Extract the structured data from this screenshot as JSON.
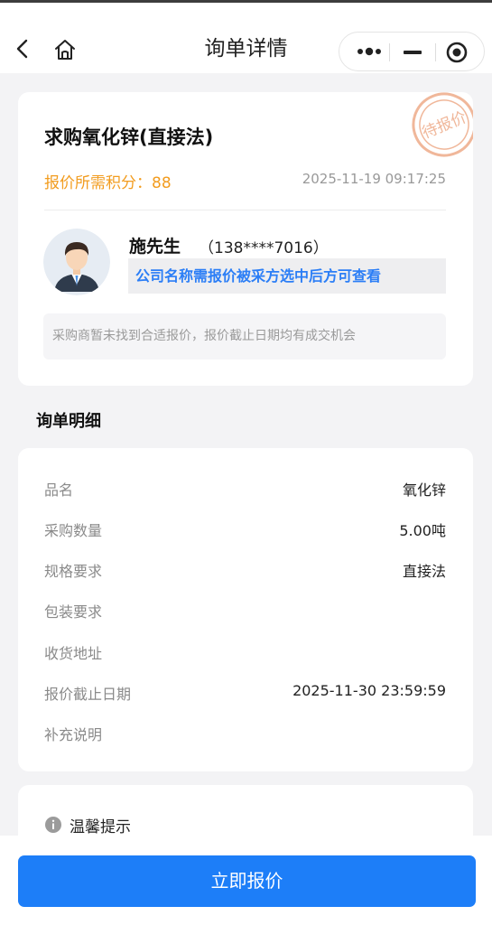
{
  "navbar": {
    "title": "询单详情",
    "back_icon": "back-arrow-icon",
    "home_icon": "home-icon",
    "capsule": {
      "more_icon": "more-dots-icon",
      "minimize_icon": "minimize-icon",
      "close_icon": "target-close-icon"
    }
  },
  "summary": {
    "title": "求购氧化锌(直接法)",
    "points_label": "报价所需积分：88",
    "date": "2025-11-19 09:17:25",
    "stamp_text": "待报价",
    "contact_name": "施先生",
    "contact_phone": "（138****7016）",
    "company_notice": "公司名称需报价被采方选中后方可查看",
    "tip": "采购商暂未找到合适报价，报价截止日期均有成交机会"
  },
  "details": {
    "section_title": "询单明细",
    "rows": [
      {
        "label": "品名",
        "value": "氧化锌"
      },
      {
        "label": "采购数量",
        "value": "5.00吨"
      },
      {
        "label": "规格要求",
        "value": "直接法"
      },
      {
        "label": "包装要求",
        "value": ""
      },
      {
        "label": "收货地址",
        "value": ""
      },
      {
        "label": "报价截止日期",
        "value": "2025-11-30 23:59:59"
      },
      {
        "label": "补充说明",
        "value": ""
      }
    ]
  },
  "warm_tip": {
    "title": "温馨提示",
    "icon": "info-icon"
  },
  "footer": {
    "button_label": "立即报价"
  },
  "colors": {
    "accent": "#1d7ef8",
    "points": "#f29c1f",
    "stamp": "#f0b79a",
    "link": "#2b7ef6"
  }
}
